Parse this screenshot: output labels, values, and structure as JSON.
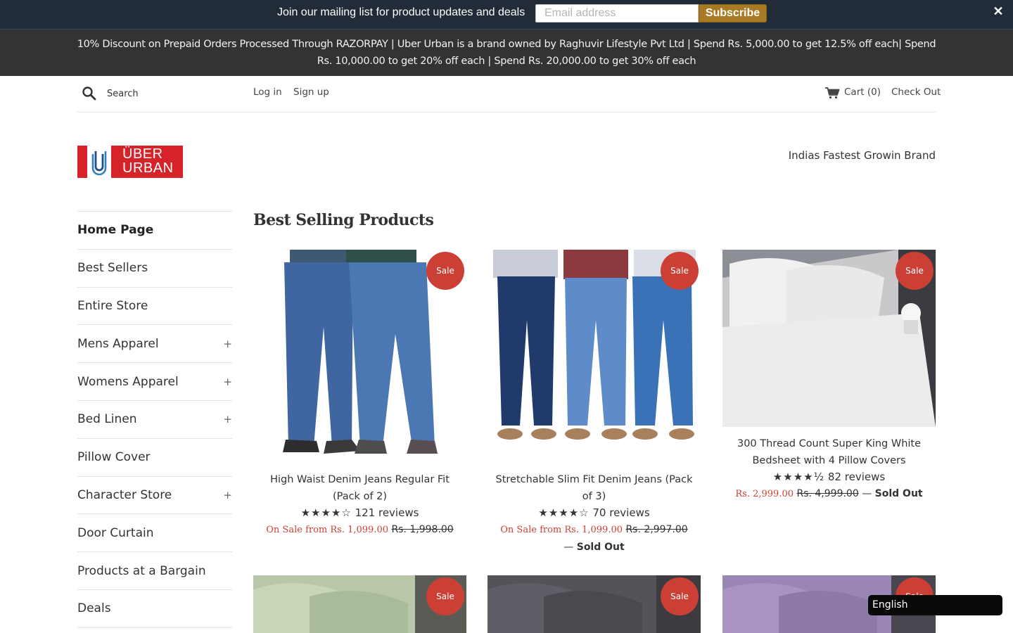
{
  "mailing": {
    "text": "Join our mailing list for product updates and deals",
    "placeholder": "Email address",
    "subscribe_label": "Subscribe",
    "close_label": "✕"
  },
  "announcement": "10% Discount on Prepaid Orders Processed Through RAZORPAY | Uber Urban is a brand owned by Raghuvir Lifestyle Pvt Ltd | Spend Rs. 5,000.00 to get 12.5% off each| Spend Rs. 10,000.00 to get 20% off each | Spend Rs. 20,000.00 to get 30% off each",
  "topnav": {
    "search_placeholder": "Search",
    "login": "Log in",
    "signup": "Sign up",
    "cart": "Cart (0)",
    "checkout": "Check Out"
  },
  "header": {
    "logo_line1": "ÜBER",
    "logo_line2": "URBAN",
    "tagline": "Indias Fastest Growin Brand"
  },
  "sidebar": {
    "items": [
      {
        "label": "Home Page",
        "active": true,
        "expand": ""
      },
      {
        "label": "Best Sellers",
        "expand": ""
      },
      {
        "label": "Entire Store",
        "expand": ""
      },
      {
        "label": "Mens Apparel",
        "expand": "+"
      },
      {
        "label": "Womens Apparel",
        "expand": "+"
      },
      {
        "label": "Bed Linen",
        "expand": "+"
      },
      {
        "label": "Pillow Cover",
        "expand": ""
      },
      {
        "label": "Character Store",
        "expand": "+"
      },
      {
        "label": "Door Curtain",
        "expand": ""
      },
      {
        "label": "Products at a Bargain",
        "expand": ""
      },
      {
        "label": "Deals",
        "expand": ""
      }
    ]
  },
  "main": {
    "title": "Best Selling Products",
    "products": [
      {
        "badge": "Sale",
        "title": "High Waist Denim Jeans Regular Fit (Pack of 2)",
        "stars": "★★★★☆",
        "reviews": "121 reviews",
        "sale_price": "On Sale from Rs. 1,099.00",
        "old_price": "Rs. 1,998.00",
        "separator": "",
        "sold_out": ""
      },
      {
        "badge": "Sale",
        "title": "Stretchable Slim Fit Denim Jeans (Pack of 3)",
        "stars": "★★★★☆",
        "reviews": "70 reviews",
        "sale_price": "On Sale from Rs. 1,099.00",
        "old_price": "Rs. 2,997.00",
        "separator": "—",
        "sold_out": "Sold Out"
      },
      {
        "badge": "Sale",
        "title": "300 Thread Count Super King White Bedsheet with 4 Pillow Covers",
        "stars": "★★★★½",
        "reviews": "82 reviews",
        "sale_price": "Rs. 2,999.00",
        "old_price": "Rs. 4,999.00",
        "separator": "—",
        "sold_out": "Sold Out"
      },
      {
        "badge": "Sale"
      },
      {
        "badge": "Sale"
      },
      {
        "badge": "Sale"
      }
    ]
  },
  "language": "English",
  "colors": {
    "accent_sale": "#cc3f35",
    "subscribe": "#a87a23",
    "logo_red": "#d6232a"
  }
}
